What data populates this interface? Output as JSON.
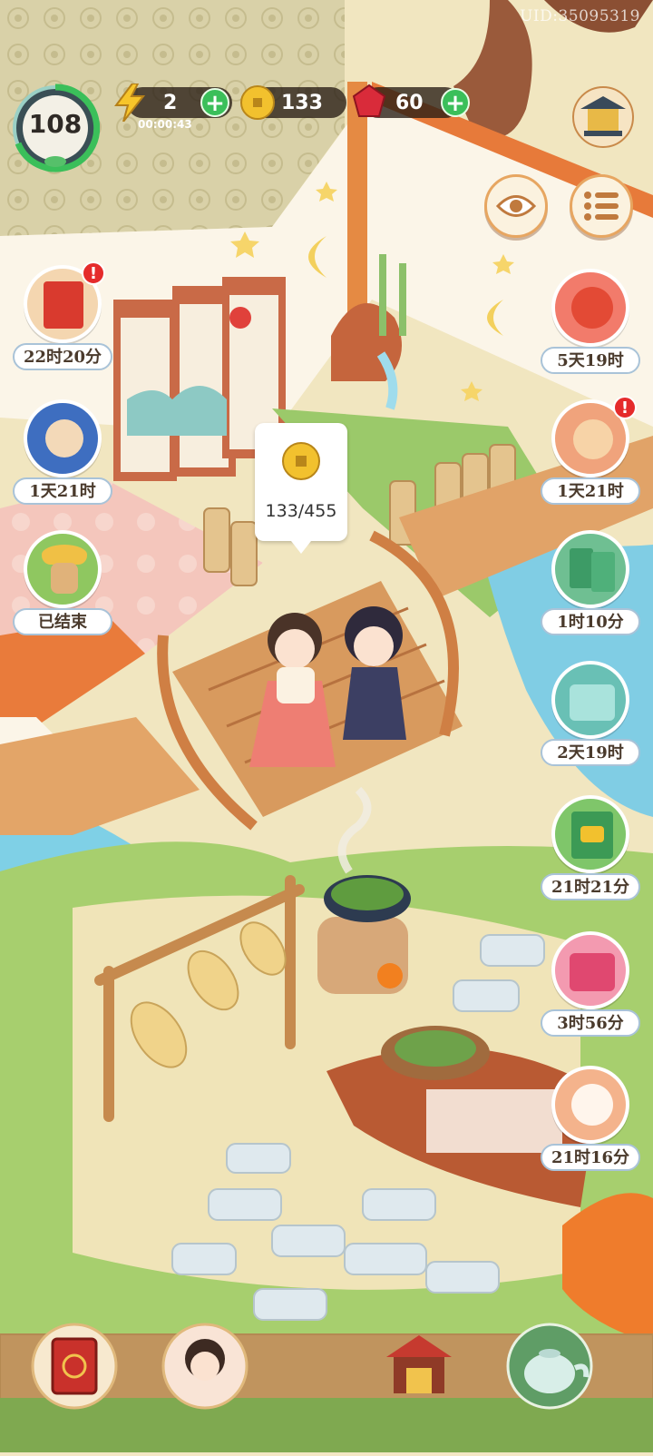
{
  "uid": "UID:35095319",
  "player": {
    "level": "108"
  },
  "resources": {
    "energy": {
      "value": "2",
      "timer": "00:00:43",
      "icon": "lightning-icon"
    },
    "coins": {
      "value": "133",
      "icon": "coin-icon"
    },
    "gems": {
      "value": "60",
      "icon": "ruby-icon"
    }
  },
  "left_events": [
    {
      "id": "red-envelope",
      "timer": "22时20分",
      "alert": "!",
      "icon": "red-envelope-icon"
    },
    {
      "id": "cat-fan",
      "timer": "1天21时",
      "icon": "cat-fan-icon"
    },
    {
      "id": "bird-scarecrow",
      "timer": "已结束",
      "icon": "scarecrow-icon"
    }
  ],
  "right_events": [
    {
      "id": "red-fox",
      "timer": "5天19时",
      "icon": "red-fox-icon"
    },
    {
      "id": "cat-fortune",
      "timer": "1天21时",
      "alert": "!",
      "icon": "cat-fortune-icon"
    },
    {
      "id": "green-tickets",
      "timer": "1时10分",
      "icon": "ticket-icon"
    },
    {
      "id": "gift-box",
      "timer": "2天19时",
      "icon": "gift-box-icon"
    },
    {
      "id": "coin-cards",
      "timer": "21时21分",
      "icon": "coin-card-icon"
    },
    {
      "id": "pink-box",
      "timer": "3时56分",
      "icon": "pink-chest-icon"
    },
    {
      "id": "white-cat",
      "timer": "21时16分",
      "icon": "white-cat-icon"
    }
  ],
  "tooltip": {
    "text": "133/455",
    "icon": "coin-icon"
  },
  "bottom_bar": [
    {
      "id": "book",
      "icon": "book-icon"
    },
    {
      "id": "character",
      "icon": "character-icon"
    },
    {
      "id": "shop",
      "icon": "shop-icon"
    },
    {
      "id": "teapot",
      "icon": "teapot-icon"
    }
  ],
  "colors": {
    "accent_green": "#3bbf5a",
    "alert_red": "#e52b2b",
    "coin_gold": "#f2c12e",
    "gem_red": "#d92b3a"
  }
}
